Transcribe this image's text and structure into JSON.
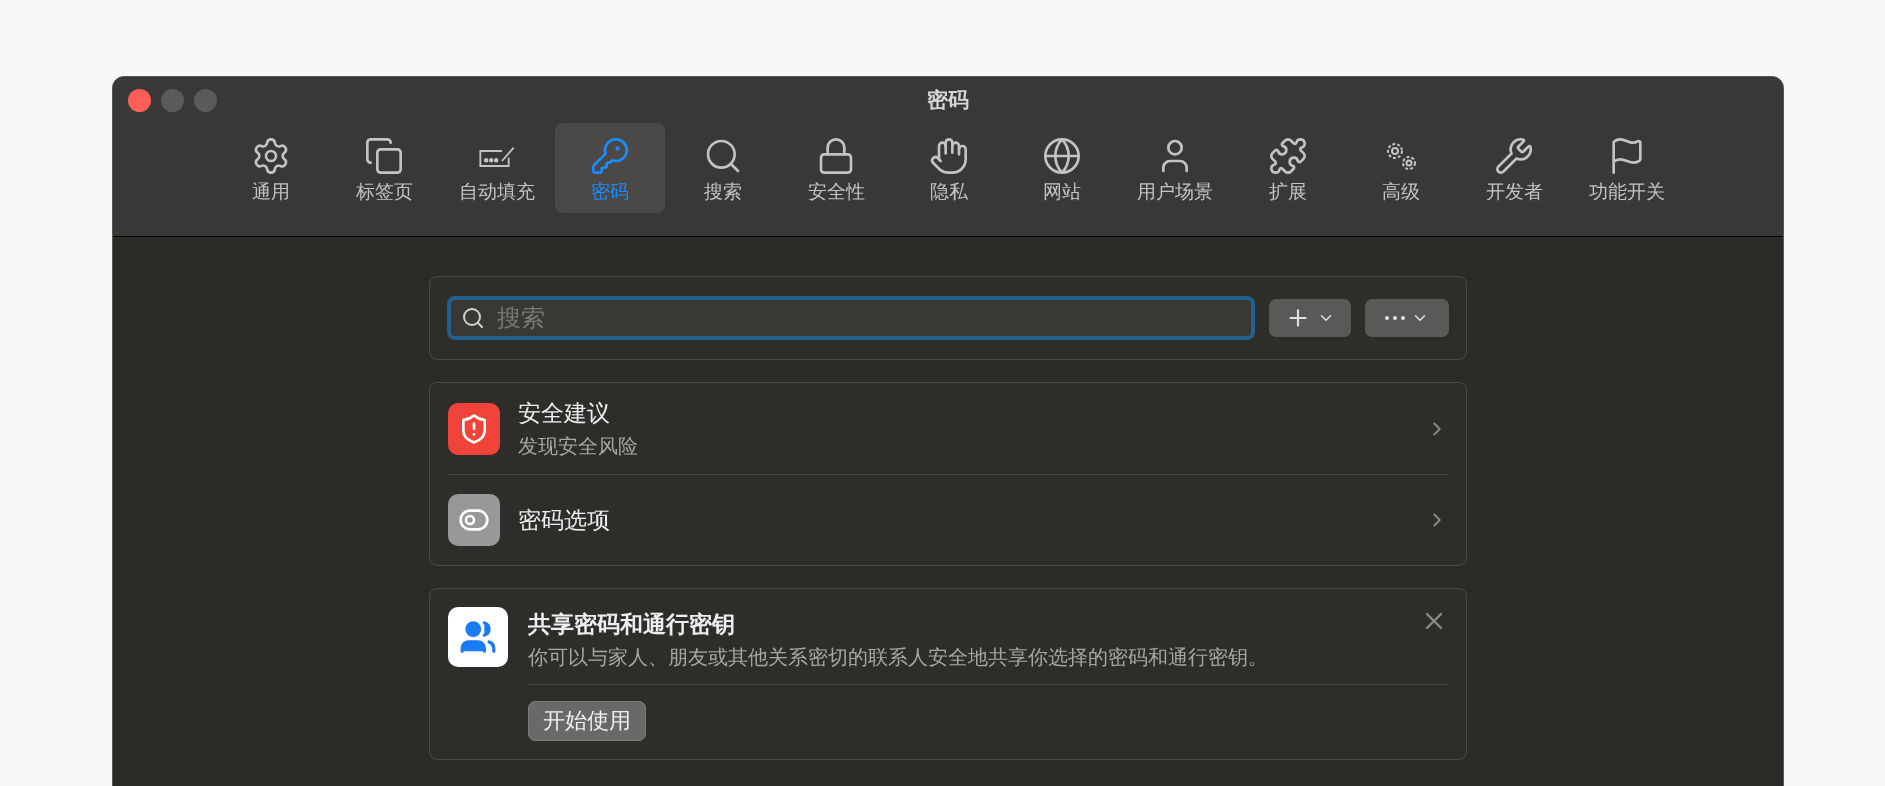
{
  "window": {
    "title": "密码"
  },
  "tabs": [
    {
      "label": "通用",
      "selected": false
    },
    {
      "label": "标签页",
      "selected": false
    },
    {
      "label": "自动填充",
      "selected": false
    },
    {
      "label": "密码",
      "selected": true
    },
    {
      "label": "搜索",
      "selected": false
    },
    {
      "label": "安全性",
      "selected": false
    },
    {
      "label": "隐私",
      "selected": false
    },
    {
      "label": "网站",
      "selected": false
    },
    {
      "label": "用户场景",
      "selected": false
    },
    {
      "label": "扩展",
      "selected": false
    },
    {
      "label": "高级",
      "selected": false
    },
    {
      "label": "开发者",
      "selected": false
    },
    {
      "label": "功能开关",
      "selected": false
    }
  ],
  "search": {
    "placeholder": "搜索"
  },
  "settings_list": [
    {
      "kind": "security",
      "title": "安全建议",
      "subtitle": "发现安全风险"
    },
    {
      "kind": "options",
      "title": "密码选项"
    }
  ],
  "sharing_card": {
    "title": "共享密码和通行密钥",
    "description": "你可以与家人、朋友或其他关系密切的联系人安全地共享你选择的密码和通行密钥。",
    "button": "开始使用"
  }
}
